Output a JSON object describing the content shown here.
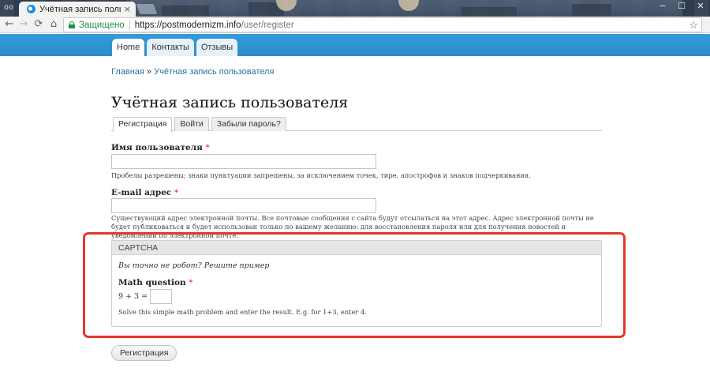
{
  "browser": {
    "tab_title": "Учётная запись пользов",
    "tab_close": "×",
    "window_controls": [
      "−",
      "☐",
      "✕"
    ],
    "nav": {
      "back": "←",
      "forward": "→",
      "reload": "⟳",
      "home": "⌂"
    },
    "secure_label": "Защищено",
    "url_host": "https://postmodernizm.info",
    "url_path": "/user/register",
    "bookmark_icon": "☆"
  },
  "site": {
    "primary_tabs": [
      {
        "label": "Home"
      },
      {
        "label": "Контакты"
      },
      {
        "label": "Отзывы"
      }
    ]
  },
  "breadcrumb": {
    "home": "Главная",
    "separator": " » ",
    "current": "Учётная запись пользователя"
  },
  "page": {
    "title": "Учётная запись пользователя",
    "tabs": [
      {
        "label": "Регистрация",
        "active": true
      },
      {
        "label": "Войти",
        "active": false
      },
      {
        "label": "Забыли пароль?",
        "active": false
      }
    ]
  },
  "form": {
    "username": {
      "label": "Имя пользователя",
      "required_mark": "*",
      "value": "",
      "description": "Пробелы разрешены; знаки пунктуации запрещены, за исключением точек, тире, апострофов и знаков подчеркивания."
    },
    "email": {
      "label": "E-mail адрес",
      "required_mark": "*",
      "value": "",
      "description": "Существующий адрес электронной почты. Все почтовые сообщения с сайта будут отсылаться на этот адрес. Адрес электронной почты не будет публиковаться и будет использован только по вашему желанию: для восстановления пароля или для получения новостей и уведомлений по электронной почте."
    },
    "captcha": {
      "legend": "CAPTCHA",
      "prompt": "Вы точно не робот? Решите пример",
      "math_label": "Math question",
      "required_mark": "*",
      "equation": "9 + 3 =",
      "value": "",
      "description": "Solve this simple math problem and enter the result. E.g. for 1+3, enter 4."
    },
    "submit_label": "Регистрация"
  },
  "colors": {
    "header_blue": "#2b8dca",
    "required_red": "#dd2222",
    "highlight_red": "#e0382b",
    "secure_green": "#1e8e3e",
    "link_blue": "#2a6fa0"
  }
}
